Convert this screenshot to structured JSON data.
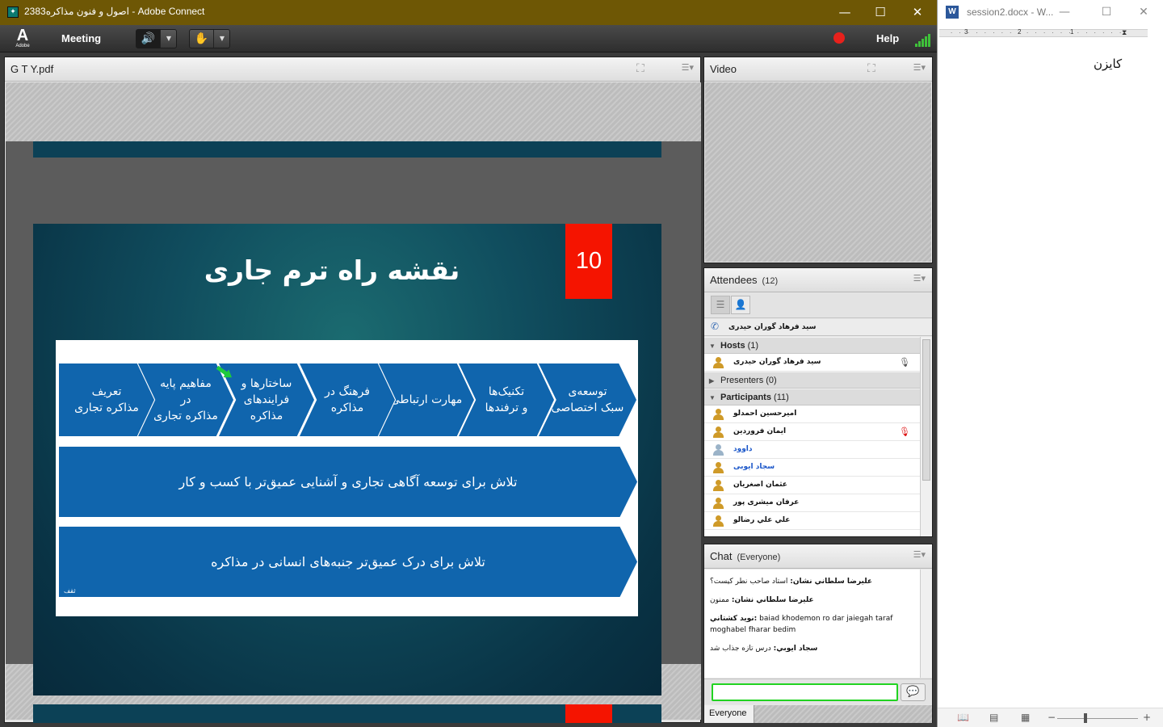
{
  "adobe_connect": {
    "window_title": "اصول و فنون مذاکره2383 - Adobe Connect",
    "controls": {
      "minimize": "—",
      "maximize": "☐",
      "close": "✕"
    },
    "menubar": {
      "logo_glyph": "A",
      "logo_word": "Adobe",
      "meeting_label": "Meeting",
      "help_label": "Help",
      "recording_color": "#e8211c",
      "speaker_icon": "🔊",
      "pod_icon": "✋"
    },
    "share_pod": {
      "title": "G T Y.pdf",
      "slide": {
        "number": "10",
        "title": "نقشه راه ترم جاری",
        "steps": [
          "تعریف\nمذاکره تجاری",
          "مفاهیم پایه\nدر\nمذاکره تجاری",
          "ساختارها و\nفرایندهای\nمذاکره",
          "فرهنگ در\nمذاکره",
          "مهارت ارتباطی",
          "تکنیک‌ها\nو ترفندها",
          "توسعه‌ی\nسبک اختصاصی"
        ],
        "arrow_1": "تلاش برای توسعه آگاهی تجاری و آشنایی عمیق‌تر با کسب و کار",
        "arrow_2": "تلاش برای درک عمیق‌تر جنبه‌های انسانی در مذاکره",
        "mark": "ثقف",
        "accent_color": "#f51400",
        "shape_color": "#1065ad"
      }
    },
    "video_pod": {
      "title": "Video"
    },
    "attendees_pod": {
      "title": "Attendees",
      "count": "(12)",
      "speaking": "سید فرهاد گوران حیدری",
      "hosts": {
        "label": "Hosts",
        "count": "(1)",
        "items": [
          {
            "name": "سید فرهاد گوران حیدری"
          }
        ]
      },
      "presenters": {
        "label": "Presenters",
        "count": "(0)"
      },
      "participants": {
        "label": "Participants",
        "count": "(11)",
        "items": [
          {
            "name": "امیرحسین احمدلو"
          },
          {
            "name": "ایمان فروردین"
          },
          {
            "name": "داوود"
          },
          {
            "name": "سجاد ایوبی"
          },
          {
            "name": "عثمان اصغریان"
          },
          {
            "name": "عرفان میشری پور"
          },
          {
            "name": "علي علي رضالو"
          }
        ]
      }
    },
    "chat_pod": {
      "title": "Chat",
      "audience": "(Everyone)",
      "messages": [
        {
          "sender": "علیرضا سلطاني نشان:",
          "text": "استاد صاحب نطر کیست؟"
        },
        {
          "sender": "علیرضا سلطاني نشان:",
          "text": "ممنون"
        },
        {
          "sender": "نوید کشتاني:",
          "text": "baiad khodemon ro dar jaiegah taraf moghabel fharar bedim"
        },
        {
          "sender": "سجاد ایوبي:",
          "text": "درس تازه جذاب شد"
        }
      ],
      "input_value": "",
      "send_icon": "💬",
      "to_label": "Everyone"
    }
  },
  "word": {
    "window_title": "session2.docx - W...",
    "controls": {
      "minimize": "—",
      "maximize": "☐",
      "close": "✕"
    },
    "icon_letter": "W",
    "ruler": {
      "marks": [
        "3",
        "2",
        "1"
      ]
    },
    "document_text": "کایزن",
    "zoom_minus": "−",
    "zoom_plus": "+"
  }
}
